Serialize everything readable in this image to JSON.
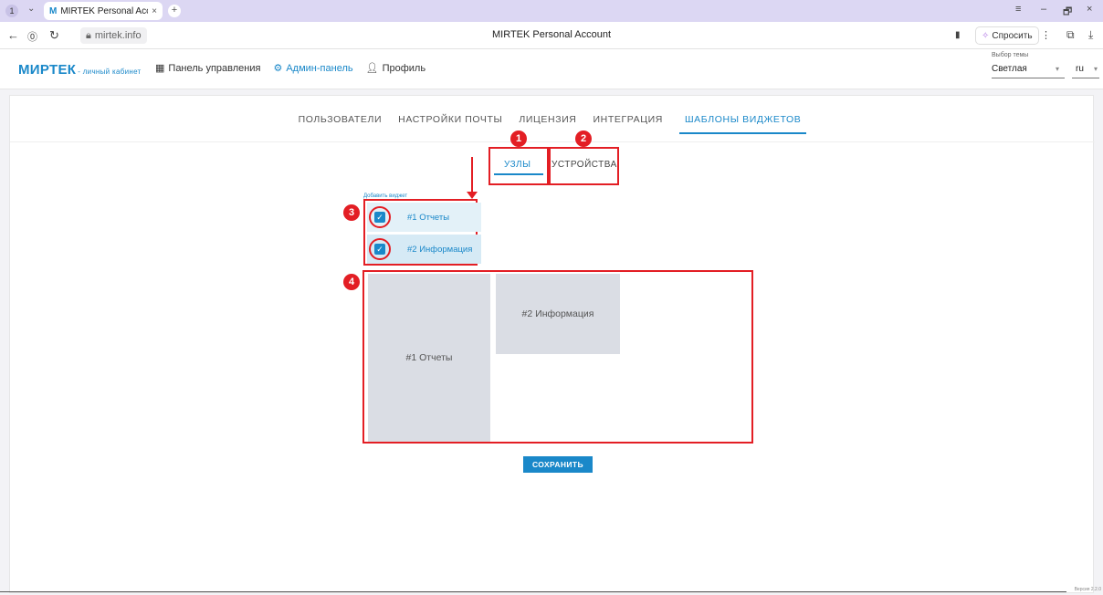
{
  "browser": {
    "tab_counter": "1",
    "tab_title": "MIRTEK Personal Accou",
    "favicon": "M",
    "url": "mirtek.info",
    "page_title": "MIRTEK Personal Account",
    "ask_label": "Спросить",
    "win_controls": [
      "≡",
      "–",
      "🗗",
      "×"
    ]
  },
  "header": {
    "logo_main": "МИРТЕК",
    "logo_sub": "- личный кабинет",
    "nav": [
      {
        "label": "Панель управления",
        "icon": "dashboard-icon"
      },
      {
        "label": "Админ-панель",
        "icon": "gear-icon"
      },
      {
        "label": "Профиль",
        "icon": "user-icon"
      }
    ],
    "theme_label": "Выбор темы",
    "theme_value": "Светлая",
    "lang_value": "ru"
  },
  "admin_tabs": [
    "ПОЛЬЗОВАТЕЛИ",
    "НАСТРОЙКИ ПОЧТЫ",
    "ЛИЦЕНЗИЯ",
    "ИНТЕГРАЦИЯ",
    "ШАБЛОНЫ ВИДЖЕТОВ"
  ],
  "admin_tab_active": "ШАБЛОНЫ ВИДЖЕТОВ",
  "sub_tabs": [
    "УЗЛЫ",
    "УСТРОЙСТВА"
  ],
  "sub_tab_active": "УЗЛЫ",
  "add_widget_label": "Добавить виджет",
  "widgets": [
    {
      "label": "#1 Отчеты",
      "checked": true
    },
    {
      "label": "#2 Информация",
      "checked": true
    }
  ],
  "tiles": [
    "#1 Отчеты",
    "#2 Информация"
  ],
  "badges": [
    "1",
    "2",
    "3",
    "4"
  ],
  "save_label": "СОХРАНИТЬ",
  "version": "Версия 2.2.0",
  "colors": {
    "accent": "#1a88c9",
    "annotation": "#e31e24",
    "tile": "#dadde4"
  }
}
